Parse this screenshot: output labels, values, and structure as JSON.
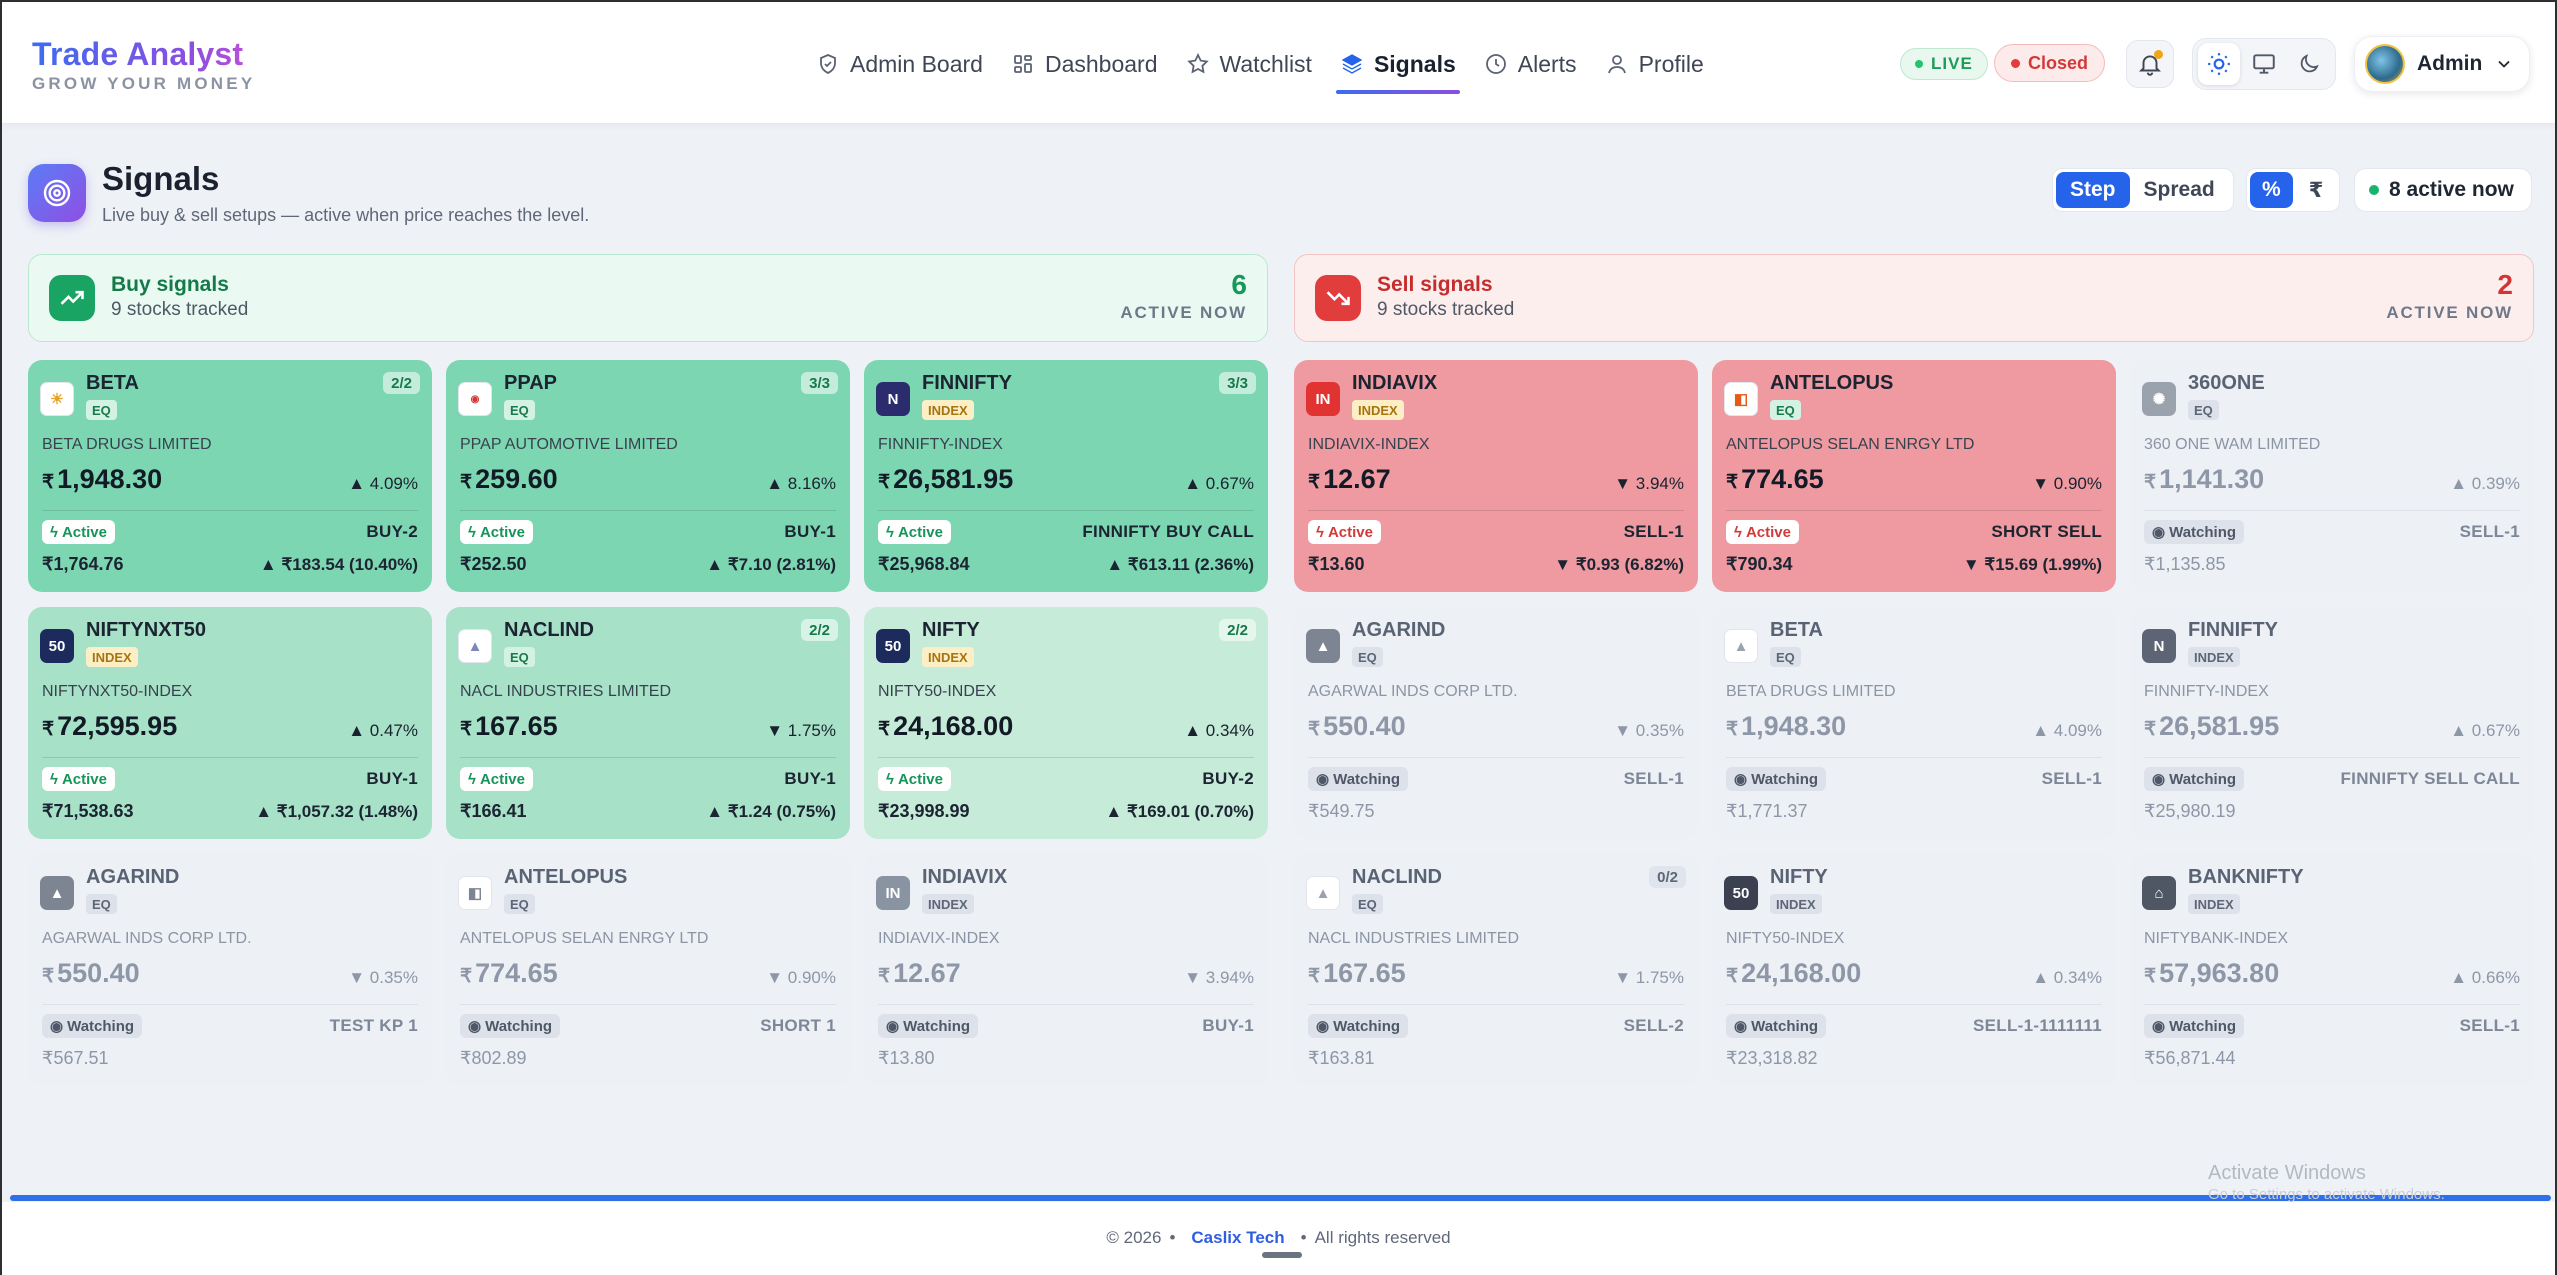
{
  "brand": {
    "title": "Trade Analyst",
    "subtitle": "GROW YOUR MONEY"
  },
  "nav": [
    {
      "label": "Admin Board",
      "icon": "shield-icon"
    },
    {
      "label": "Dashboard",
      "icon": "grid-icon"
    },
    {
      "label": "Watchlist",
      "icon": "star-icon"
    },
    {
      "label": "Signals",
      "icon": "layers-icon",
      "active": true
    },
    {
      "label": "Alerts",
      "icon": "clock-icon"
    },
    {
      "label": "Profile",
      "icon": "user-icon"
    }
  ],
  "status": {
    "live": "LIVE",
    "market": "Closed"
  },
  "user": {
    "name": "Admin"
  },
  "page": {
    "title": "Signals",
    "subtitle": "Live buy & sell setups — active when price reaches the level.",
    "mode_step": "Step",
    "mode_spread": "Spread",
    "unit_pct": "%",
    "unit_rupee": "₹",
    "active_now": "8 active now"
  },
  "summary": {
    "buy": {
      "title": "Buy signals",
      "sub": "9 stocks tracked",
      "count": "6",
      "label": "ACTIVE NOW"
    },
    "sell": {
      "title": "Sell signals",
      "sub": "9 stocks tracked",
      "count": "2",
      "label": "ACTIVE NOW"
    }
  },
  "cards": [
    {
      "name": "BETA",
      "tag": "EQ",
      "badge": "2/2",
      "full": "BETA DRUGS LIMITED",
      "cur": "₹",
      "price": "1,948.30",
      "pct": "▲ 4.09%",
      "status": "Active",
      "signal": "BUY-2",
      "target": "₹1,764.76",
      "diff": "▲ ₹183.54 (10.40%)"
    },
    {
      "name": "PPAP",
      "tag": "EQ",
      "badge": "3/3",
      "full": "PPAP AUTOMOTIVE LIMITED",
      "cur": "₹",
      "price": "259.60",
      "pct": "▲ 8.16%",
      "status": "Active",
      "signal": "BUY-1",
      "target": "₹252.50",
      "diff": "▲ ₹7.10 (2.81%)"
    },
    {
      "name": "FINNIFTY",
      "tag": "INDEX",
      "badge": "3/3",
      "full": "FINNIFTY-INDEX",
      "cur": "₹",
      "price": "26,581.95",
      "pct": "▲ 0.67%",
      "status": "Active",
      "signal": "FINNIFTY BUY CALL",
      "target": "₹25,968.84",
      "diff": "▲ ₹613.11 (2.36%)"
    },
    {
      "name": "INDIAVIX",
      "logo": "IN",
      "tag": "INDEX",
      "badge": "",
      "full": "INDIAVIX-INDEX",
      "cur": "₹",
      "price": "12.67",
      "pct": "▼ 3.94%",
      "status": "Active",
      "signal": "SELL-1",
      "target": "₹13.60",
      "diff": "▼ ₹0.93 (6.82%)"
    },
    {
      "name": "ANTELOPUS",
      "tag": "EQ",
      "badge": "",
      "full": "ANTELOPUS SELAN ENRGY LTD",
      "cur": "₹",
      "price": "774.65",
      "pct": "▼ 0.90%",
      "status": "Active",
      "signal": "SHORT SELL",
      "target": "₹790.34",
      "diff": "▼ ₹15.69 (1.99%)"
    },
    {
      "name": "360ONE",
      "tag": "EQ",
      "badge": "",
      "full": "360 ONE WAM LIMITED",
      "cur": "₹",
      "price": "1,141.30",
      "pct": "▲ 0.39%",
      "status": "Watching",
      "signal": "SELL-1",
      "target": "₹1,135.85",
      "diff": ""
    },
    {
      "name": "NIFTYNXT50",
      "logo": "50",
      "tag": "INDEX",
      "badge": "",
      "full": "NIFTYNXT50-INDEX",
      "cur": "₹",
      "price": "72,595.95",
      "pct": "▲ 0.47%",
      "status": "Active",
      "signal": "BUY-1",
      "target": "₹71,538.63",
      "diff": "▲ ₹1,057.32 (1.48%)"
    },
    {
      "name": "NACLIND",
      "tag": "EQ",
      "badge": "2/2",
      "full": "NACL INDUSTRIES LIMITED",
      "cur": "₹",
      "price": "167.65",
      "pct": "▼ 1.75%",
      "status": "Active",
      "signal": "BUY-1",
      "target": "₹166.41",
      "diff": "▲ ₹1.24 (0.75%)"
    },
    {
      "name": "NIFTY",
      "logo": "50",
      "tag": "INDEX",
      "badge": "2/2",
      "full": "NIFTY50-INDEX",
      "cur": "₹",
      "price": "24,168.00",
      "pct": "▲ 0.34%",
      "status": "Active",
      "signal": "BUY-2",
      "target": "₹23,998.99",
      "diff": "▲ ₹169.01 (0.70%)"
    },
    {
      "name": "AGARIND",
      "tag": "EQ",
      "badge": "",
      "full": "AGARWAL INDS CORP LTD.",
      "cur": "₹",
      "price": "550.40",
      "pct": "▼ 0.35%",
      "status": "Watching",
      "signal": "SELL-1",
      "target": "₹549.75",
      "diff": ""
    },
    {
      "name": "BETA",
      "tag": "EQ",
      "badge": "",
      "full": "BETA DRUGS LIMITED",
      "cur": "₹",
      "price": "1,948.30",
      "pct": "▲ 4.09%",
      "status": "Watching",
      "signal": "SELL-1",
      "target": "₹1,771.37",
      "diff": ""
    },
    {
      "name": "FINNIFTY",
      "tag": "INDEX",
      "badge": "",
      "full": "FINNIFTY-INDEX",
      "cur": "₹",
      "price": "26,581.95",
      "pct": "▲ 0.67%",
      "status": "Watching",
      "signal": "FINNIFTY SELL CALL",
      "target": "₹25,980.19",
      "diff": ""
    },
    {
      "name": "AGARIND",
      "tag": "EQ",
      "badge": "",
      "full": "AGARWAL INDS CORP LTD.",
      "cur": "₹",
      "price": "550.40",
      "pct": "▼ 0.35%",
      "status": "Watching",
      "signal": "TEST KP 1",
      "target": "₹567.51",
      "diff": ""
    },
    {
      "name": "ANTELOPUS",
      "tag": "EQ",
      "badge": "",
      "full": "ANTELOPUS SELAN ENRGY LTD",
      "cur": "₹",
      "price": "774.65",
      "pct": "▼ 0.90%",
      "status": "Watching",
      "signal": "SHORT 1",
      "target": "₹802.89",
      "diff": ""
    },
    {
      "name": "INDIAVIX",
      "logo": "IN",
      "tag": "INDEX",
      "badge": "",
      "full": "INDIAVIX-INDEX",
      "cur": "₹",
      "price": "12.67",
      "pct": "▼ 3.94%",
      "status": "Watching",
      "signal": "BUY-1",
      "target": "₹13.80",
      "diff": ""
    },
    {
      "name": "NACLIND",
      "tag": "EQ",
      "badge": "0/2",
      "full": "NACL INDUSTRIES LIMITED",
      "cur": "₹",
      "price": "167.65",
      "pct": "▼ 1.75%",
      "status": "Watching",
      "signal": "SELL-2",
      "target": "₹163.81",
      "diff": ""
    },
    {
      "name": "NIFTY",
      "logo": "50",
      "tag": "INDEX",
      "badge": "",
      "full": "NIFTY50-INDEX",
      "cur": "₹",
      "price": "24,168.00",
      "pct": "▲ 0.34%",
      "status": "Watching",
      "signal": "SELL-1-1111111",
      "target": "₹23,318.82",
      "diff": ""
    },
    {
      "name": "BANKNIFTY",
      "tag": "INDEX",
      "badge": "",
      "full": "NIFTYBANK-INDEX",
      "cur": "₹",
      "price": "57,963.80",
      "pct": "▲ 0.66%",
      "status": "Watching",
      "signal": "SELL-1",
      "target": "₹56,871.44",
      "diff": ""
    }
  ],
  "footer": {
    "copy": "© 2026",
    "company": "Caslix Tech",
    "rights": "All rights reserved"
  },
  "watermark": {
    "title": "Activate Windows",
    "sub": "Go to Settings to activate Windows."
  },
  "colors": {
    "accent": "#2563eb",
    "buy": "#19a463",
    "sell": "#e23d3d"
  }
}
